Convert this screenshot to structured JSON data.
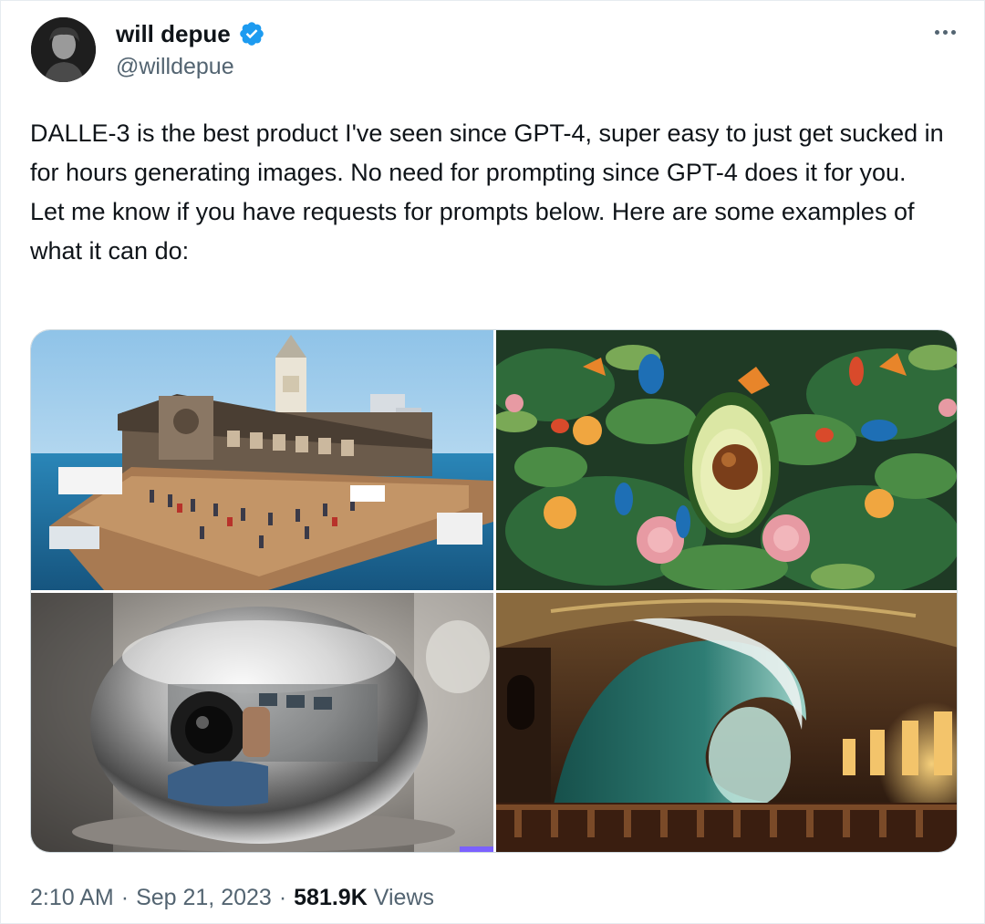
{
  "author": {
    "display_name": "will depue",
    "handle": "@willdepue",
    "verified_icon": "verified-badge-icon",
    "avatar_icon": "avatar"
  },
  "menu": {
    "more_icon": "more-horizontal-icon"
  },
  "tweet": {
    "lines": [
      "DALLE-3 is the best product I've seen since GPT-4, super easy to just get sucked in for hours generating images. No need for prompting since GPT-4 does it for you.",
      "Let me know if you have requests for prompts below. Here are some examples of what it can do:"
    ]
  },
  "media": {
    "images": [
      {
        "name": "image-ferry-building-pier"
      },
      {
        "name": "image-avocado-jungle"
      },
      {
        "name": "image-chrome-sphere-photographer"
      },
      {
        "name": "image-wave-in-palace-hall"
      }
    ]
  },
  "meta": {
    "time": "2:10 AM",
    "separator": "·",
    "date": "Sep 21, 2023",
    "views_count": "581.9K",
    "views_label": "Views"
  },
  "colors": {
    "text_primary": "#0f1419",
    "text_secondary": "#536471",
    "verified_blue": "#1d9bf0",
    "border": "#cfd9de"
  }
}
